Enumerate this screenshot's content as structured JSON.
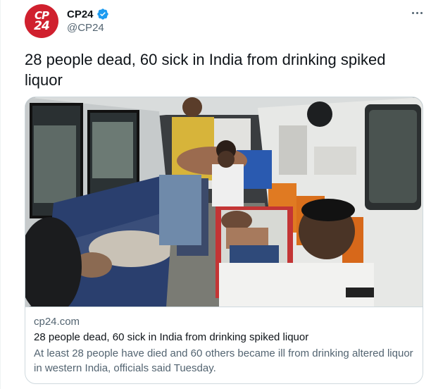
{
  "account": {
    "display_name": "CP24",
    "handle": "@CP24",
    "avatar_line1": "CP",
    "avatar_line2": "24"
  },
  "tweet": {
    "text": "28 people dead, 60 sick in India from drinking spiked liquor"
  },
  "card": {
    "domain": "cp24.com",
    "title": "28 people dead, 60 sick in India from drinking spiked liquor",
    "description": "At least 28 people have died and 60 others became ill from drinking altered liquor in western India, officials said Tuesday."
  },
  "icons": {
    "verified": "verified-badge-icon",
    "more": "more-options-icon"
  },
  "colors": {
    "brand_red": "#d0202e",
    "verified_blue": "#1d9bf0",
    "secondary_text": "#536471"
  }
}
